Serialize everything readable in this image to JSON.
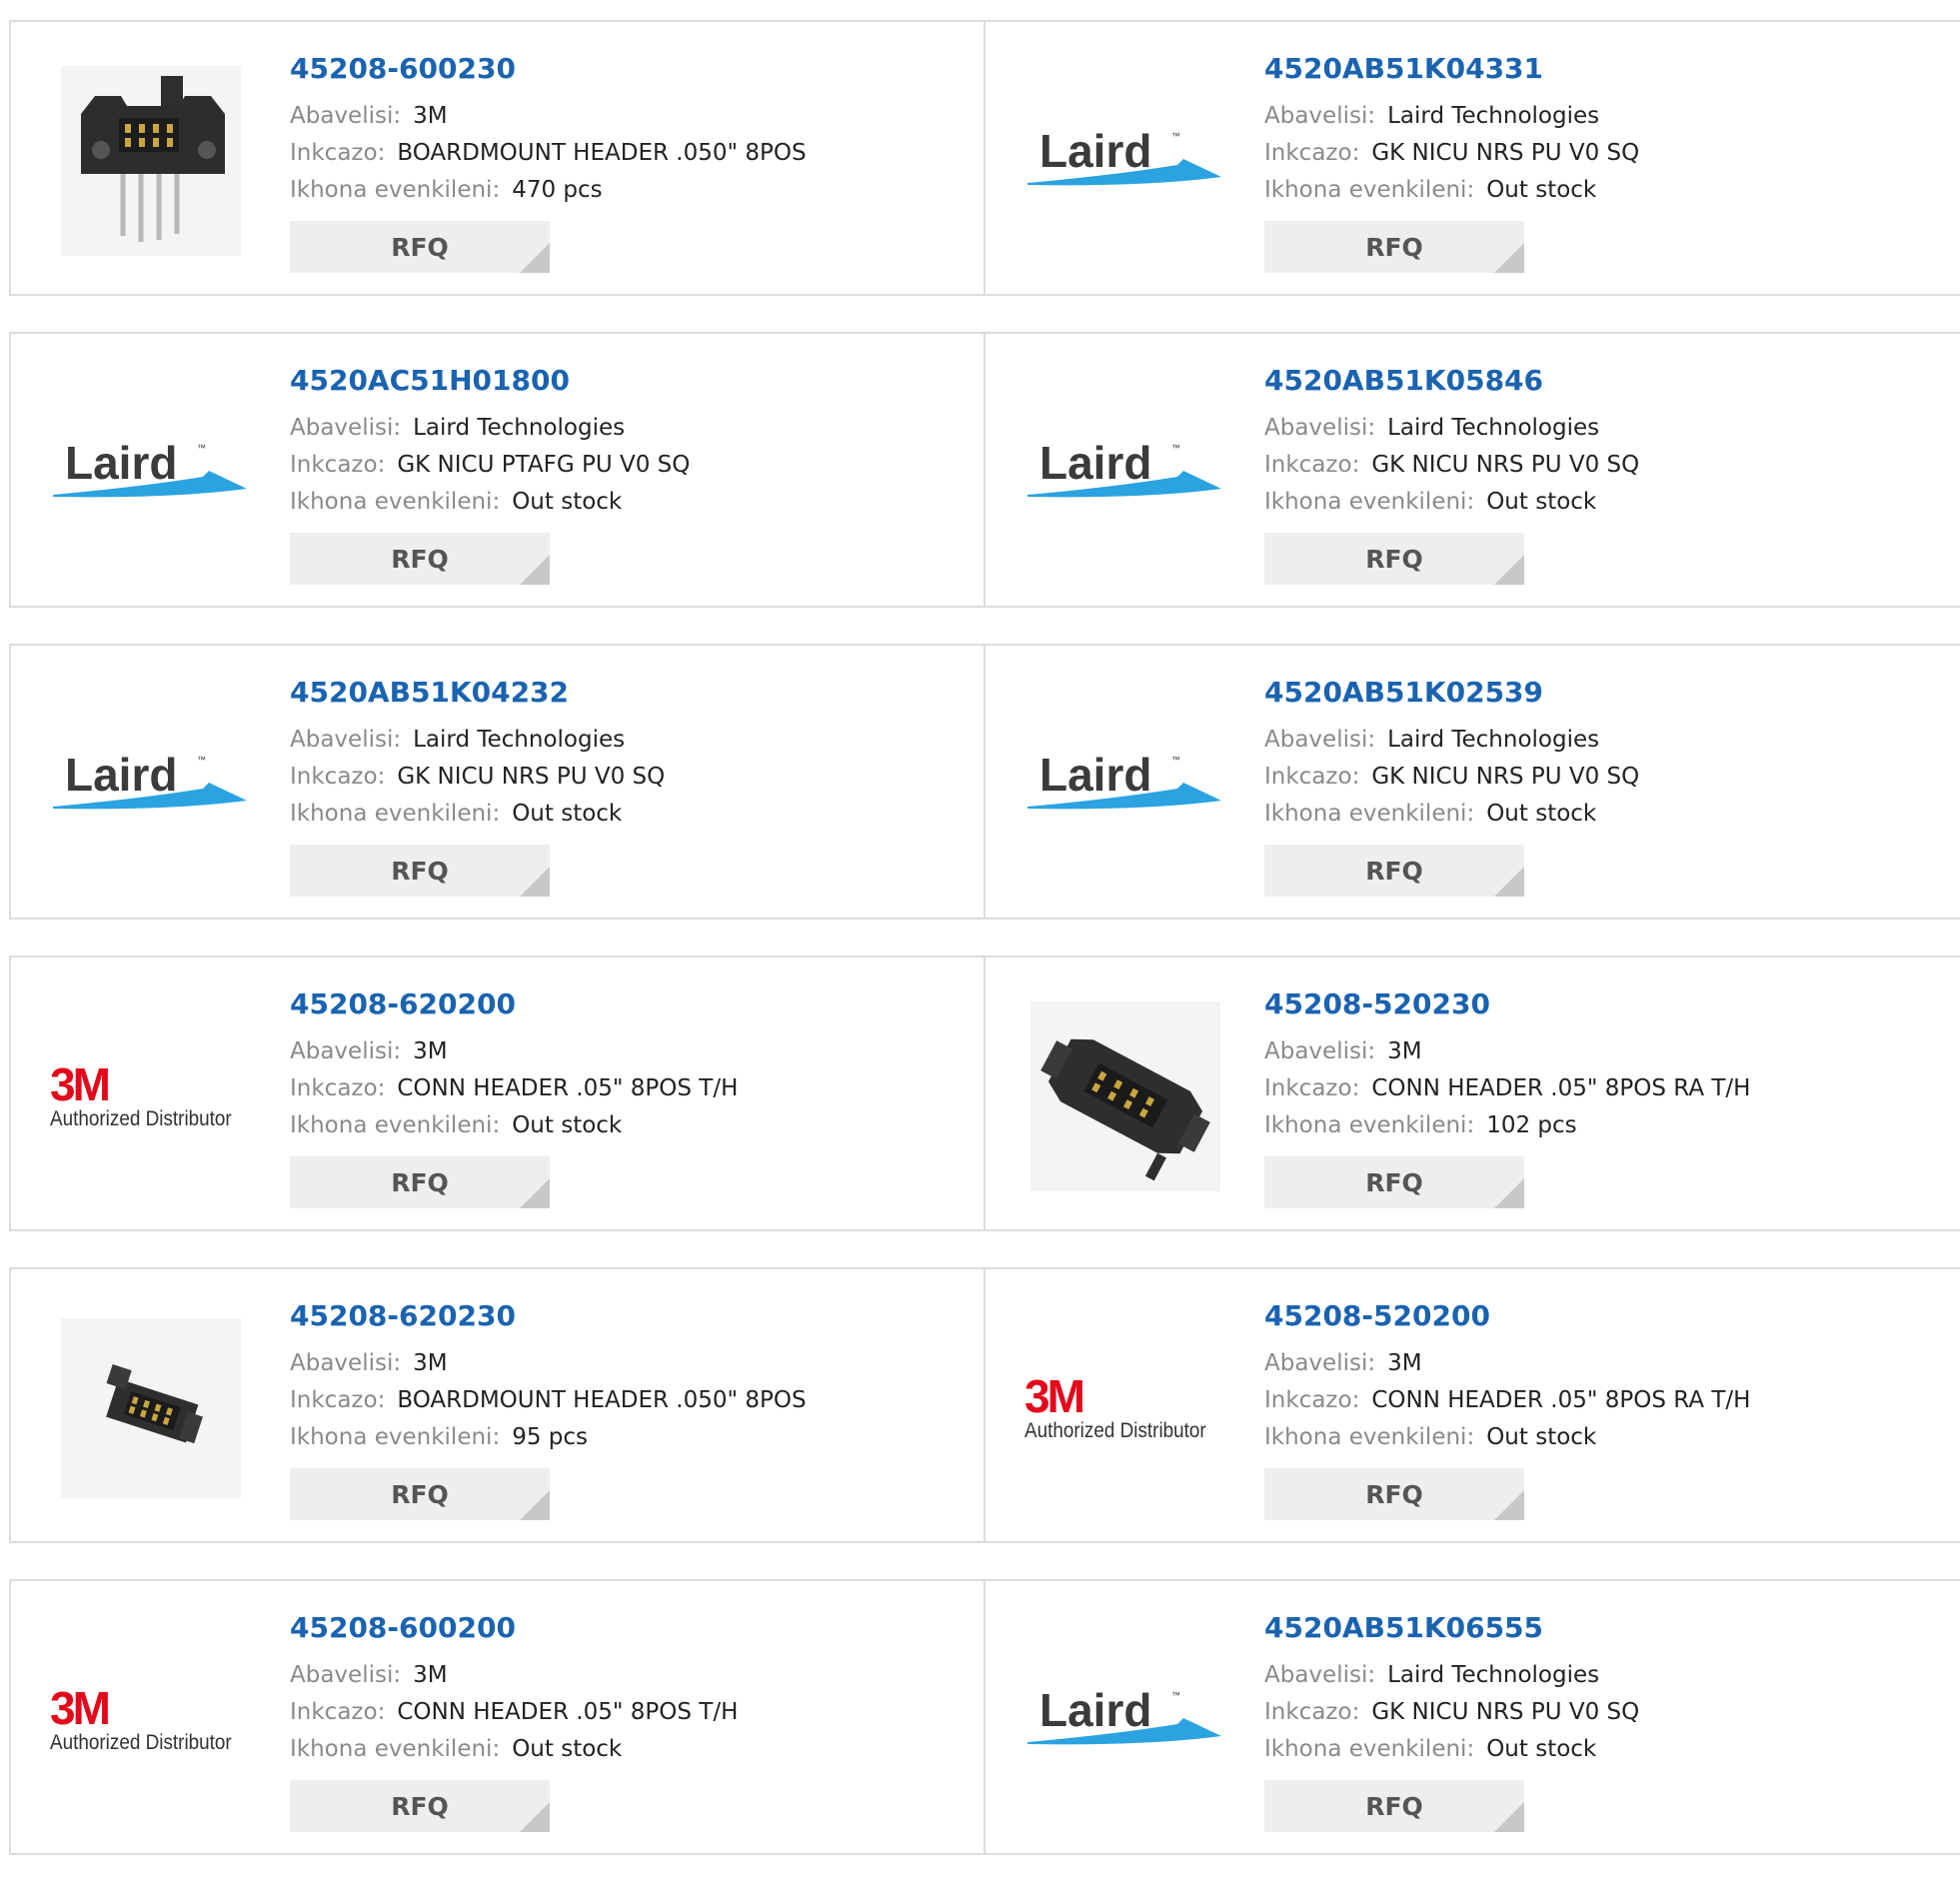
{
  "labels": {
    "manufacturer": "Abavelisi:",
    "description": "Inkcazo:",
    "stock": "Ikhona evenkileni:",
    "rfq": "RFQ"
  },
  "logos": {
    "laird": "Laird",
    "tm": "™",
    "threem": "3M",
    "authorized": "Authorized Distributor"
  },
  "colors": {
    "part_link": "#1a63b0",
    "label": "#8a8a8a",
    "rfq_bg": "#eeeeee",
    "laird_swoosh": "#2aa3e0",
    "brand_3m": "#e3091a"
  },
  "products": [
    {
      "part": "45208-600230",
      "manufacturer": "3M",
      "description": "BOARDMOUNT HEADER .050\" 8POS",
      "stock": "470 pcs",
      "image": "connector-upright-photo"
    },
    {
      "part": "4520AB51K04331",
      "manufacturer": "Laird Technologies",
      "description": "GK NICU NRS PU V0 SQ",
      "stock": "Out stock",
      "image": "laird-logo"
    },
    {
      "part": "4520AC51H01800",
      "manufacturer": "Laird Technologies",
      "description": "GK NICU PTAFG PU V0 SQ",
      "stock": "Out stock",
      "image": "laird-logo"
    },
    {
      "part": "4520AB51K05846",
      "manufacturer": "Laird Technologies",
      "description": "GK NICU NRS PU V0 SQ",
      "stock": "Out stock",
      "image": "laird-logo"
    },
    {
      "part": "4520AB51K04232",
      "manufacturer": "Laird Technologies",
      "description": "GK NICU NRS PU V0 SQ",
      "stock": "Out stock",
      "image": "laird-logo"
    },
    {
      "part": "4520AB51K02539",
      "manufacturer": "Laird Technologies",
      "description": "GK NICU NRS PU V0 SQ",
      "stock": "Out stock",
      "image": "laird-logo"
    },
    {
      "part": "45208-620200",
      "manufacturer": "3M",
      "description": "CONN HEADER .05\" 8POS T/H",
      "stock": "Out stock",
      "image": "3m-logo"
    },
    {
      "part": "45208-520230",
      "manufacturer": "3M",
      "description": "CONN HEADER .05\" 8POS RA T/H",
      "stock": "102 pcs",
      "image": "connector-angled-photo"
    },
    {
      "part": "45208-620230",
      "manufacturer": "3M",
      "description": "BOARDMOUNT HEADER .050\" 8POS",
      "stock": "95 pcs",
      "image": "connector-small-photo"
    },
    {
      "part": "45208-520200",
      "manufacturer": "3M",
      "description": "CONN HEADER .05\" 8POS RA T/H",
      "stock": "Out stock",
      "image": "3m-logo"
    },
    {
      "part": "45208-600200",
      "manufacturer": "3M",
      "description": "CONN HEADER .05\" 8POS T/H",
      "stock": "Out stock",
      "image": "3m-logo"
    },
    {
      "part": "4520AB51K06555",
      "manufacturer": "Laird Technologies",
      "description": "GK NICU NRS PU V0 SQ",
      "stock": "Out stock",
      "image": "laird-logo"
    }
  ]
}
